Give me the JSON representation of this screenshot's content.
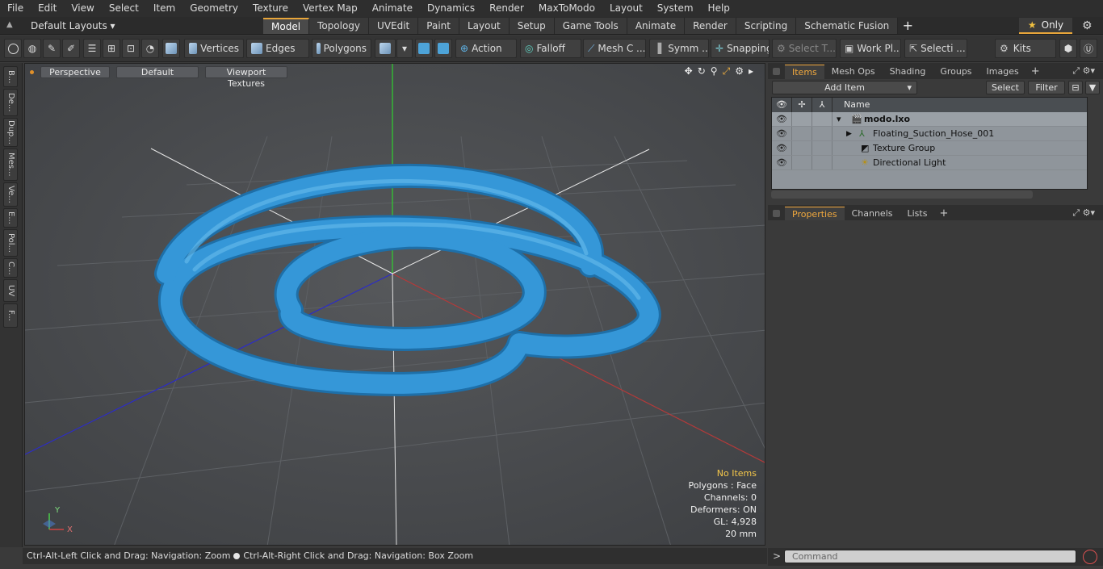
{
  "menu": [
    "File",
    "Edit",
    "View",
    "Select",
    "Item",
    "Geometry",
    "Texture",
    "Vertex Map",
    "Animate",
    "Dynamics",
    "Render",
    "MaxToModo",
    "Layout",
    "System",
    "Help"
  ],
  "layout_selector": "Default Layouts ▾",
  "tabs": [
    "Model",
    "Topology",
    "UVEdit",
    "Paint",
    "Layout",
    "Setup",
    "Game Tools",
    "Animate",
    "Render",
    "Scripting",
    "Schematic Fusion"
  ],
  "tab_plus": "+",
  "only_label": "Only",
  "toolbar": {
    "vertices": "Vertices",
    "edges": "Edges",
    "polygons": "Polygons",
    "action": "Action",
    "falloff": "Falloff",
    "mesh_c": "Mesh C ...",
    "symm": "Symm ...",
    "snapping": "Snapping",
    "select_t": "Select T...",
    "work_pl": "Work Pl...",
    "selecti": "Selecti ...",
    "kits": "Kits"
  },
  "left_tabs": [
    "B...",
    "De...",
    "Dup...",
    "Mes...",
    "Ve...",
    "E...",
    "Pol...",
    "C...",
    "UV",
    "F..."
  ],
  "viewport": {
    "view": "Perspective",
    "shading": "Default",
    "textures": "Viewport Textures",
    "info": {
      "no_items": "No Items",
      "polygons": "Polygons : Face",
      "channels": "Channels: 0",
      "deformers": "Deformers: ON",
      "gl": "GL: 4,928",
      "unit": "20 mm"
    },
    "axis_y": "Y",
    "axis_x": "X",
    "hose_color": "#2f8fd0"
  },
  "status": {
    "left": "Ctrl-Alt-Left Click and Drag: Navigation: Zoom",
    "right": "Ctrl-Alt-Right Click and Drag: Navigation: Box Zoom"
  },
  "items_panel": {
    "tabs": [
      "Items",
      "Mesh Ops",
      "Shading",
      "Groups",
      "Images"
    ],
    "add_item": "Add Item",
    "select": "Select",
    "filter": "Filter",
    "column_name": "Name",
    "rows": [
      {
        "name": "modo.lxo"
      },
      {
        "name": "Floating_Suction_Hose_001"
      },
      {
        "name": "Texture Group"
      },
      {
        "name": "Directional Light"
      }
    ]
  },
  "props_panel": {
    "tabs": [
      "Properties",
      "Channels",
      "Lists"
    ]
  },
  "command": {
    "prompt": ">",
    "placeholder": "Command"
  }
}
